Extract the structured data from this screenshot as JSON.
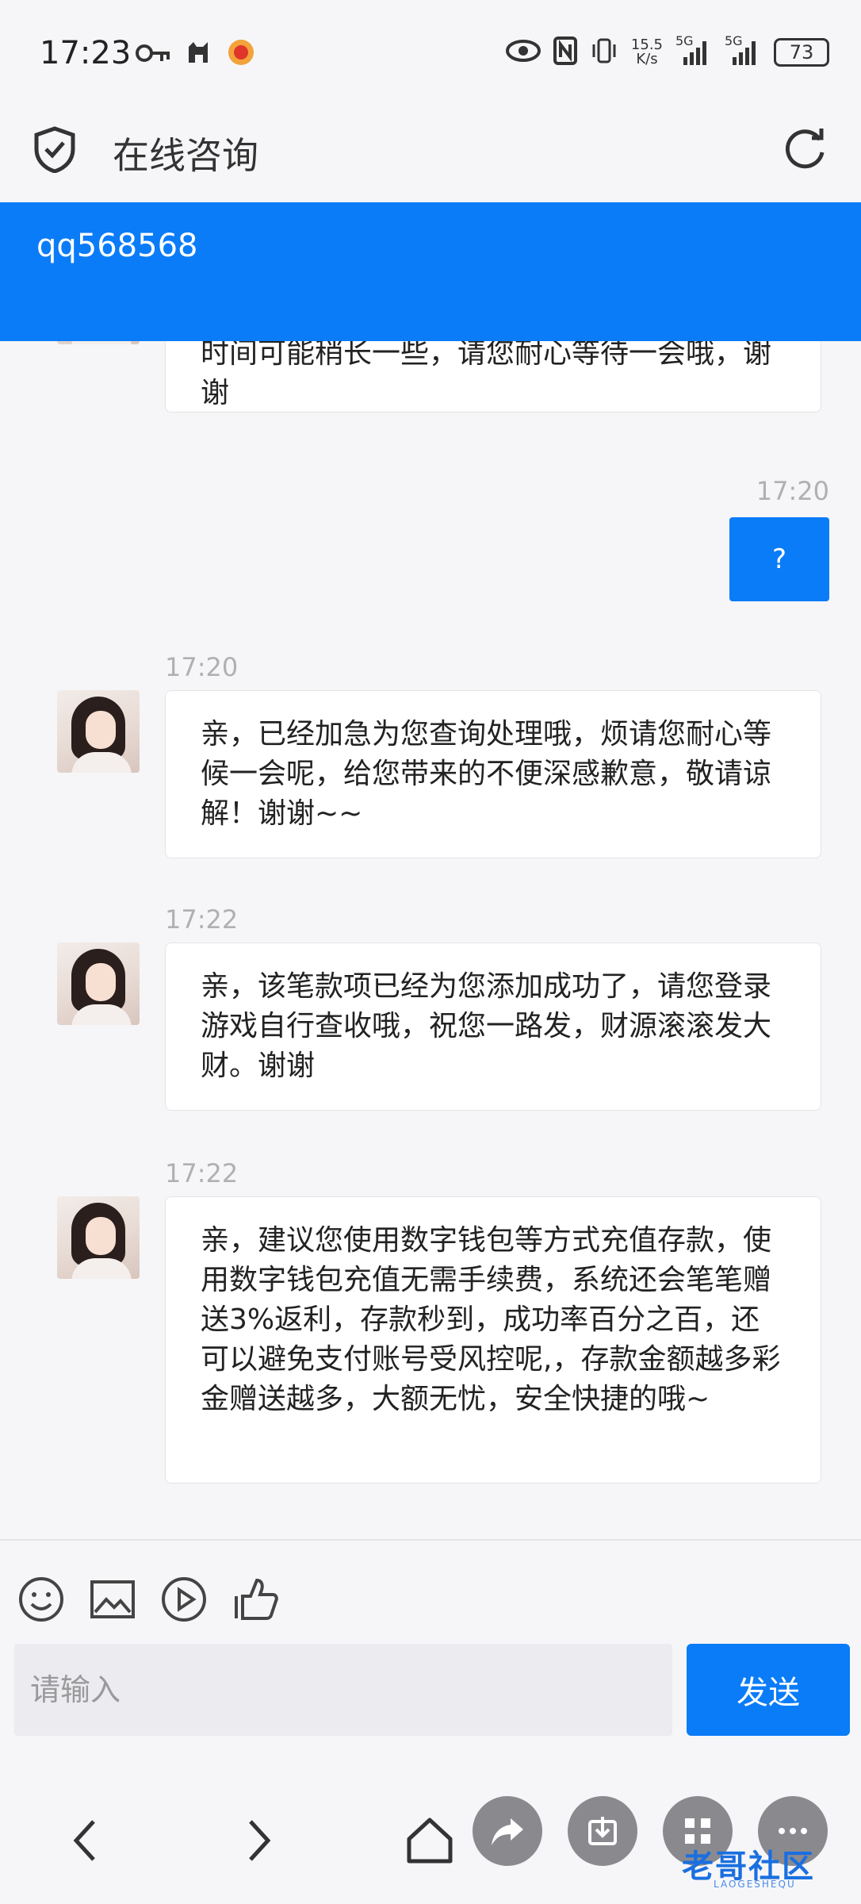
{
  "status_bar": {
    "time": "17:23",
    "left_icons": [
      "key-icon",
      "cat-icon",
      "app-notification-icon"
    ],
    "net_speed_top": "15.5",
    "net_speed_bottom": "K/s",
    "sig1": "5G",
    "sig2": "5G",
    "battery": "73"
  },
  "header": {
    "title": "在线咨询"
  },
  "banner": {
    "text": "qq568568"
  },
  "messages": [
    {
      "side": "left",
      "text": "时间可能稍长一些，请您耐心等待一会哦，谢谢",
      "time": ""
    },
    {
      "side": "right",
      "text": "?",
      "time": "17:20"
    },
    {
      "side": "left",
      "text": "亲，已经加急为您查询处理哦，烦请您耐心等候一会呢，给您带来的不便深感歉意，敬请谅解！谢谢~~",
      "time": "17:20"
    },
    {
      "side": "left",
      "text": "亲，该笔款项已经为您添加成功了，请您登录游戏自行查收哦，祝您一路发，财源滚滚发大财。谢谢",
      "time": "17:22"
    },
    {
      "side": "left",
      "text": "亲，建议您使用数字钱包等方式充值存款，使用数字钱包充值无需手续费，系统还会笔笔赠送3%返利，存款秒到，成功率百分之百，还可以避免支付账号受风控呢,，存款金额越多彩金赠送越多，大额无忧，安全快捷的哦~",
      "time": "17:22"
    }
  ],
  "input": {
    "placeholder": "请输入",
    "send_label": "发送",
    "tools": [
      "emoji-icon",
      "image-icon",
      "video-icon",
      "thumbs-up-icon"
    ]
  },
  "bottom_nav": {
    "items": [
      "back-icon",
      "forward-icon",
      "home-icon",
      "share-icon",
      "download-icon",
      "tabs-icon",
      "more-icon"
    ]
  },
  "watermark": {
    "text": "老哥社区",
    "sub": "LAOGESHEQU"
  },
  "colors": {
    "accent": "#0a7cf8",
    "background": "#f6f6f8",
    "bubble": "#ffffff"
  }
}
